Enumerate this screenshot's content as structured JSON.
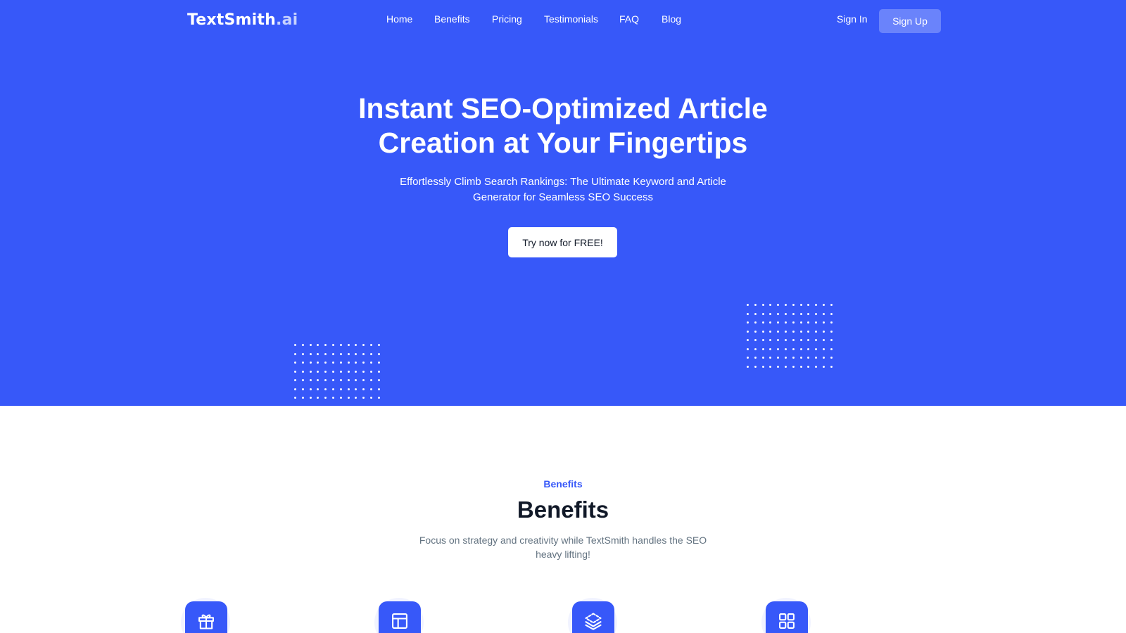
{
  "header": {
    "logo_main": "TextSmith",
    "logo_suffix": ".ai",
    "nav": [
      "Home",
      "Benefits",
      "Pricing",
      "Testimonials",
      "FAQ",
      "Blog"
    ],
    "sign_in": "Sign In",
    "sign_up": "Sign Up"
  },
  "hero": {
    "title_line1": "Instant SEO-Optimized Article",
    "title_line2": "Creation at Your Fingertips",
    "subtitle_line1": "Effortlessly Climb Search Rankings: The Ultimate Keyword and Article",
    "subtitle_line2": "Generator for Seamless SEO Success",
    "cta": "Try now for FREE!"
  },
  "benefits": {
    "eyebrow": "Benefits",
    "title": "Benefits",
    "subtitle_line1": "Focus on strategy and creativity while TextSmith handles the SEO",
    "subtitle_line2": "heavy lifting!",
    "icons": [
      "gift-icon",
      "layout-icon",
      "layers-icon",
      "grid-icon"
    ]
  },
  "colors": {
    "primary": "#3758f9",
    "white": "#ffffff",
    "heading": "#111928",
    "body_text": "#637381"
  }
}
